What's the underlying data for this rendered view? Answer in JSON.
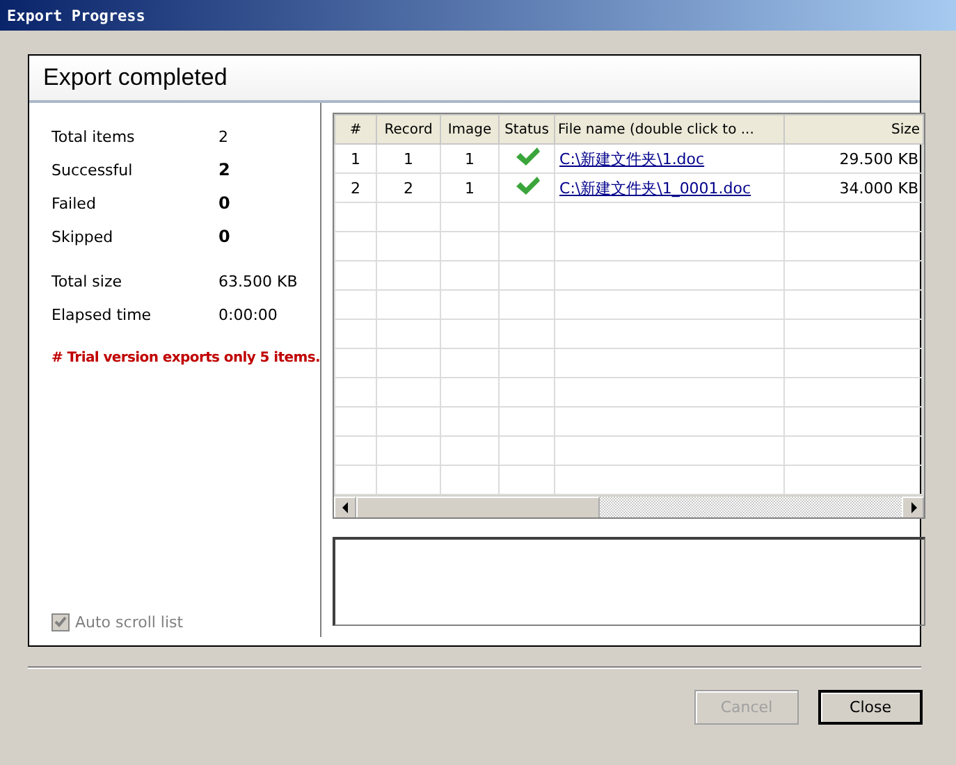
{
  "window": {
    "title": "Export Progress"
  },
  "header": {
    "title": "Export completed"
  },
  "stat_groups": [
    [
      {
        "label": "Total items",
        "value": "2",
        "bold": false
      },
      {
        "label": "Successful",
        "value": "2",
        "bold": true
      },
      {
        "label": "Failed",
        "value": "0",
        "bold": true
      },
      {
        "label": "Skipped",
        "value": "0",
        "bold": true
      }
    ],
    [
      {
        "label": "Total size",
        "value": "63.500 KB",
        "bold": false
      },
      {
        "label": "Elapsed time",
        "value": "0:00:00",
        "bold": false
      }
    ]
  ],
  "notice": "# Trial version exports only 5 items.",
  "auto_scroll": {
    "label": "Auto scroll list",
    "checked": true,
    "disabled": true
  },
  "table": {
    "columns": [
      "#",
      "Record",
      "Image",
      "Status",
      "File name (double click to ...",
      "Size"
    ],
    "rows": [
      {
        "index": "1",
        "record": "1",
        "image": "1",
        "kind": "success",
        "file": "C:\\新建文件夹\\1.doc",
        "size": "29.500 KB"
      },
      {
        "index": "2",
        "record": "2",
        "image": "1",
        "kind": "success",
        "file": "C:\\新建文件夹\\1_0001.doc",
        "size": "34.000 KB"
      }
    ]
  },
  "buttons": [
    {
      "label": "Cancel",
      "disabled": true
    },
    {
      "label": "Close",
      "disabled": false
    }
  ]
}
